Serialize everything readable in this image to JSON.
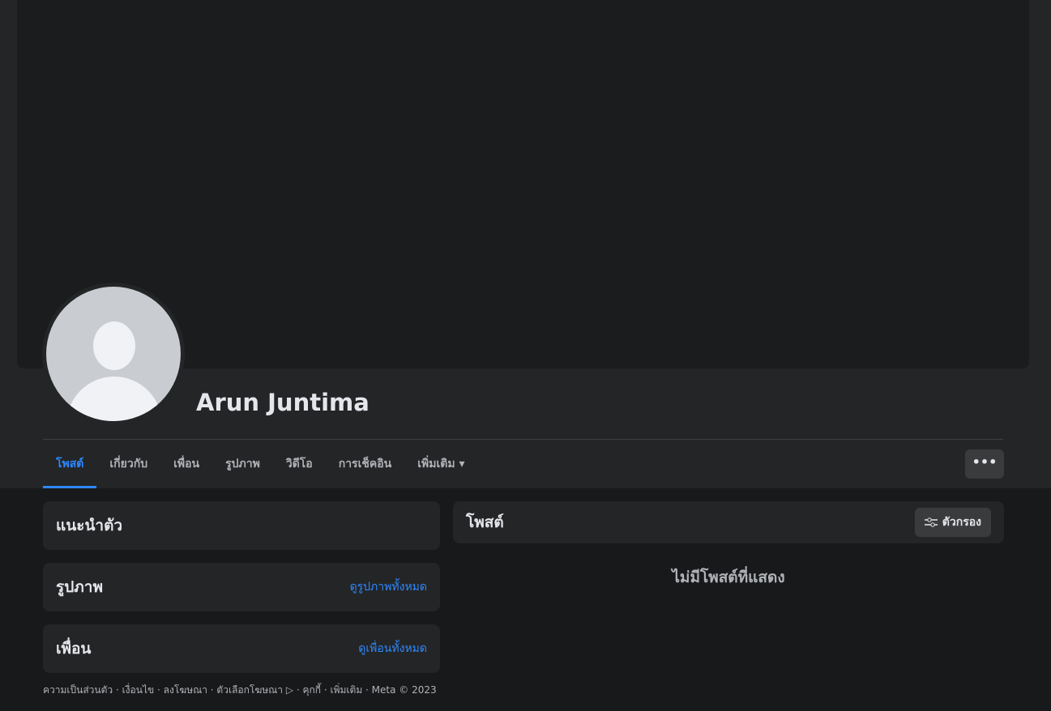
{
  "profile": {
    "name": "Arun Juntima"
  },
  "tabs": [
    {
      "label": "โพสต์"
    },
    {
      "label": "เกี่ยวกับ"
    },
    {
      "label": "เพื่อน"
    },
    {
      "label": "รูปภาพ"
    },
    {
      "label": "วิดีโอ"
    },
    {
      "label": "การเช็คอิน"
    },
    {
      "label": "เพิ่มเติม ▾"
    }
  ],
  "more_button": "•••",
  "left": {
    "intro": {
      "title": "แนะนำตัว"
    },
    "photos": {
      "title": "รูปภาพ",
      "link": "ดูรูปภาพทั้งหมด"
    },
    "friends": {
      "title": "เพื่อน",
      "link": "ดูเพื่อนทั้งหมด"
    }
  },
  "posts": {
    "title": "โพสต์",
    "filter_label": "ตัวกรอง",
    "empty": "ไม่มีโพสต์ที่แสดง"
  },
  "footer": "ความเป็นส่วนตัว · เงื่อนไข · ลงโฆษณา · ตัวเลือกโฆษณา ▷ · คุกกี้ · เพิ่มเติม · Meta © 2023",
  "colors": {
    "accent": "#2d88ff",
    "bg": "#18191a",
    "surface": "#242526"
  }
}
